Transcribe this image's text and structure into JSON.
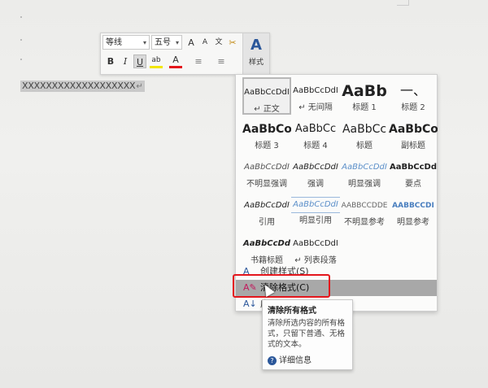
{
  "document": {
    "text": "XXXXXXXXXXXXXXXXXXX",
    "para_mark": "↵"
  },
  "mini_toolbar": {
    "font": "等线",
    "size": "五号",
    "grow": "A",
    "shrink": "A",
    "phonetic": "文",
    "format_painter": "✂",
    "bold": "B",
    "italic": "I",
    "underline": "U",
    "highlight": "ab",
    "font_color": "A",
    "bullets": "≡",
    "numbering": "≡",
    "styles_icon": "A",
    "styles_label": "样式"
  },
  "styles": [
    {
      "preview": "AaBbCcDdI",
      "name": "↵ 正文"
    },
    {
      "preview": "AaBbCcDdI",
      "name": "↵ 无间隔"
    },
    {
      "preview": "AaBb",
      "name": "标题 1"
    },
    {
      "preview": "一、",
      "name": "标题 2"
    },
    {
      "preview": "AaBbCo",
      "name": "标题 3"
    },
    {
      "preview": "AaBbCc",
      "name": "标题 4"
    },
    {
      "preview": "AaBbCc",
      "name": "标题"
    },
    {
      "preview": "AaBbCo",
      "name": "副标题"
    },
    {
      "preview": "AaBbCcDdI",
      "name": "不明显强调"
    },
    {
      "preview": "AaBbCcDdI",
      "name": "强调"
    },
    {
      "preview": "AaBbCcDdI",
      "name": "明显强调"
    },
    {
      "preview": "AaBbCcDd",
      "name": "要点"
    },
    {
      "preview": "AaBbCcDdI",
      "name": "引用"
    },
    {
      "preview": "AaBbCcDdI",
      "name": "明显引用"
    },
    {
      "preview": "AABBCCDDE",
      "name": "不明显参考"
    },
    {
      "preview": "AABBCCDI",
      "name": "明显参考"
    },
    {
      "preview": "AaBbCcDd",
      "name": "书籍标题"
    },
    {
      "preview": "AaBbCcDdI",
      "name": "↵ 列表段落"
    }
  ],
  "menu": {
    "create_style": "创建样式(S)",
    "clear_format": "清除格式(C)",
    "apply_styles": "应"
  },
  "tooltip": {
    "title": "清除所有格式",
    "body": "清除所选内容的所有格式，只留下普通、无格式的文本。",
    "more": "详细信息"
  },
  "colors": {
    "accent": "#2b579a",
    "highlight_box": "#e4161c",
    "hover": "#a8a8a8"
  }
}
